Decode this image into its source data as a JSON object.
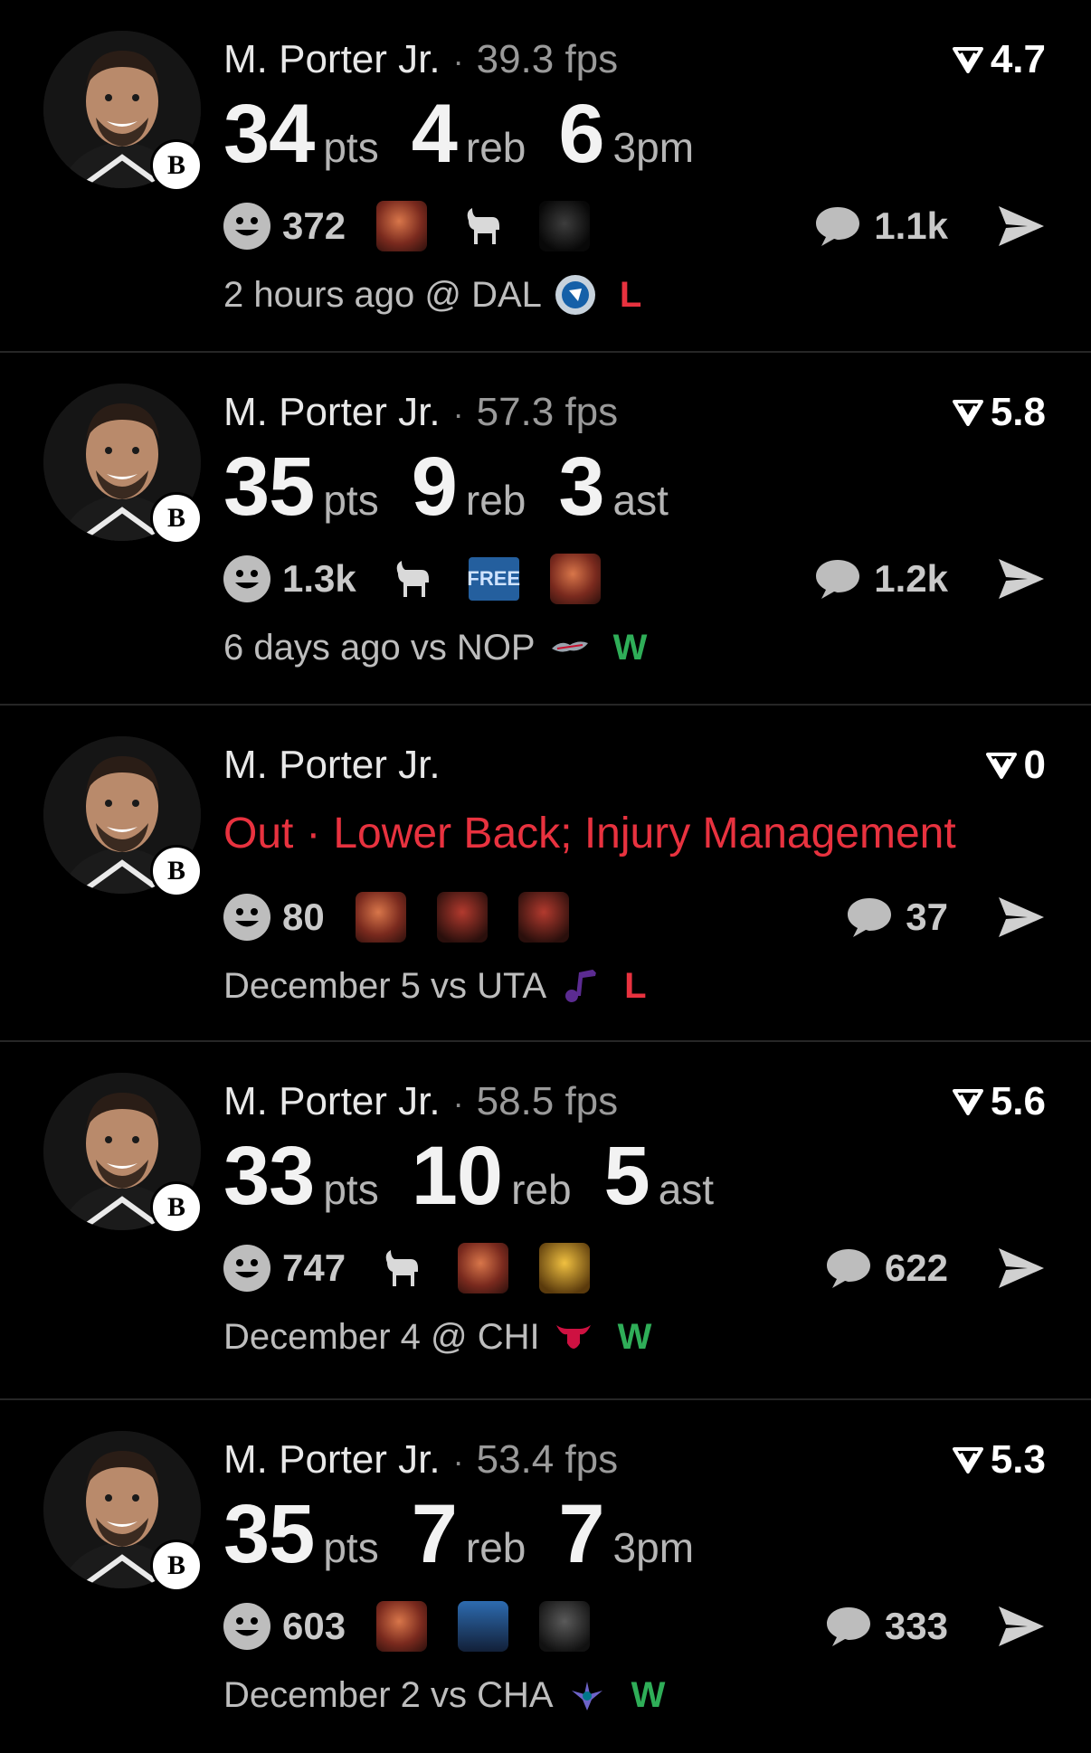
{
  "colors": {
    "loss": "#e8323f",
    "win": "#2fae58",
    "injury": "#e8323f"
  },
  "icons": {
    "reactions": "smile-icon",
    "comments": "chat-bubble-icon",
    "share": "paper-plane-icon",
    "rating": "rating-v-icon",
    "team": "nets-logo"
  },
  "feed": [
    {
      "name": "M. Porter Jr.",
      "fps": "39.3 fps",
      "rating": "4.7",
      "stats": [
        {
          "value": "34",
          "unit": "pts"
        },
        {
          "value": "4",
          "unit": "reb"
        },
        {
          "value": "6",
          "unit": "3pm"
        }
      ],
      "reaction_count": "372",
      "comment_count": "1.1k",
      "time": "2 hours ago @ DAL",
      "result": "L"
    },
    {
      "name": "M. Porter Jr.",
      "fps": "57.3 fps",
      "rating": "5.8",
      "stats": [
        {
          "value": "35",
          "unit": "pts"
        },
        {
          "value": "9",
          "unit": "reb"
        },
        {
          "value": "3",
          "unit": "ast"
        }
      ],
      "reaction_count": "1.3k",
      "free_label": "FREE",
      "comment_count": "1.2k",
      "time": "6 days ago vs NOP",
      "result": "W"
    },
    {
      "name": "M. Porter Jr.",
      "rating": "0",
      "status": "Out",
      "injury": "Lower Back; Injury Management",
      "reaction_count": "80",
      "comment_count": "37",
      "time": "December 5 vs UTA",
      "result": "L"
    },
    {
      "name": "M. Porter Jr.",
      "fps": "58.5 fps",
      "rating": "5.6",
      "stats": [
        {
          "value": "33",
          "unit": "pts"
        },
        {
          "value": "10",
          "unit": "reb"
        },
        {
          "value": "5",
          "unit": "ast"
        }
      ],
      "reaction_count": "747",
      "comment_count": "622",
      "time": "December 4 @ CHI",
      "result": "W"
    },
    {
      "name": "M. Porter Jr.",
      "fps": "53.4 fps",
      "rating": "5.3",
      "stats": [
        {
          "value": "35",
          "unit": "pts"
        },
        {
          "value": "7",
          "unit": "reb"
        },
        {
          "value": "7",
          "unit": "3pm"
        }
      ],
      "reaction_count": "603",
      "comment_count": "333",
      "time": "December 2 vs CHA",
      "result": "W"
    }
  ]
}
